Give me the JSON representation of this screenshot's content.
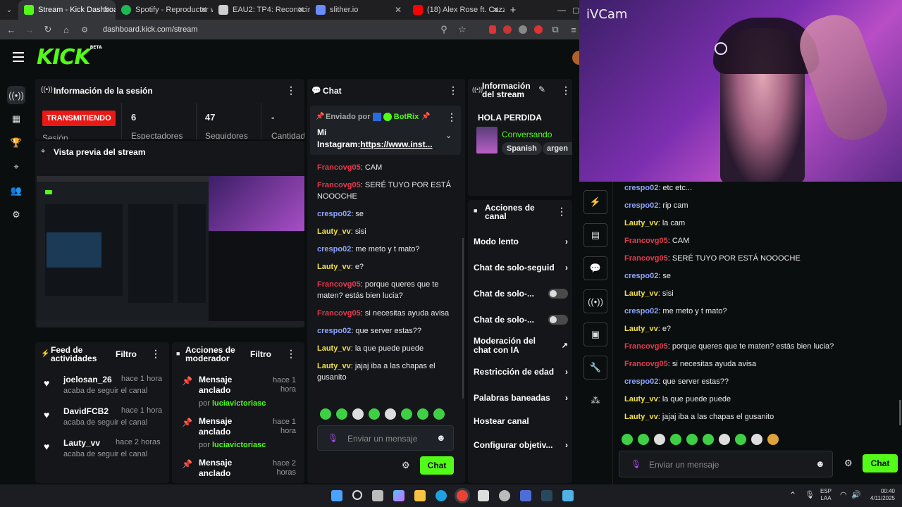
{
  "browser": {
    "tabs": [
      {
        "title": "Stream - Kick Dashboard",
        "color": "#53fc18"
      },
      {
        "title": "Spotify - Reproductor web",
        "color": "#1db954"
      },
      {
        "title": "EAU2: TP4: Reconocimien",
        "color": "#cfcfcf"
      },
      {
        "title": "slither.io",
        "color": "#6a8cff"
      },
      {
        "title": "(18) Alex Rose ft. Cazz",
        "color": "#ff0000"
      }
    ],
    "url": "dashboard.kick.com/stream"
  },
  "kick": {
    "logo": "KICK",
    "logo_suffix": "BETA",
    "session": {
      "title": "Información de la sesión",
      "status": "TRANSMITIENDO",
      "stats": [
        {
          "value": "6",
          "label": "Espectadores"
        },
        {
          "value": "47",
          "label": "Seguidores"
        },
        {
          "value": "-",
          "label": "Cantidad"
        }
      ],
      "status_label": "Sesión"
    },
    "preview": {
      "title": "Vista previa del stream"
    },
    "feed": {
      "title": "Feed de actividades",
      "filter": "Filtro",
      "items": [
        {
          "user": "joelosan_26",
          "desc": "acaba de seguir el canal",
          "time": "hace 1 hora"
        },
        {
          "user": "DavidFCB2",
          "desc": "acaba de seguir el canal",
          "time": "hace 1 hora"
        },
        {
          "user": "Lauty_vv",
          "desc": "acaba de seguir el canal",
          "time": "hace 2 horas"
        }
      ]
    },
    "modactions": {
      "title": "Acciones de moderador",
      "filter": "Filtro",
      "items": [
        {
          "title": "Mensaje anclado",
          "by_prefix": "por",
          "by": "luciavictoriasc",
          "time": "hace 1 hora"
        },
        {
          "title": "Mensaje anclado",
          "by_prefix": "por",
          "by": "luciavictoriasc",
          "time": "hace 1 hora"
        },
        {
          "title": "Mensaje anclado",
          "by_prefix": "",
          "by": "",
          "time": "hace 2 horas"
        }
      ]
    },
    "chat": {
      "title": "Chat",
      "pinned_prefix": "Enviado por",
      "pinned_by": "BotRix",
      "pinned_msg_line1": "Mi",
      "pinned_msg_line2": "Instagram:",
      "pinned_link": "https://www.inst...",
      "messages": [
        {
          "user": "Francovg05",
          "color": "red",
          "text": ": CAM"
        },
        {
          "user": "Francovg05",
          "color": "red",
          "text": ": SERÉ TUYO POR ESTÁ NOOOCHE"
        },
        {
          "user": "crespo02",
          "color": "blue",
          "text": ": se"
        },
        {
          "user": "Lauty_vv",
          "color": "yellow",
          "text": ": sisi"
        },
        {
          "user": "crespo02",
          "color": "blue",
          "text": ": me meto y t mato?"
        },
        {
          "user": "Lauty_vv",
          "color": "yellow",
          "text": ": e?"
        },
        {
          "user": "Francovg05",
          "color": "red",
          "text": ": porque queres que te maten? estás bien lucia?"
        },
        {
          "user": "Francovg05",
          "color": "red",
          "text": ": si necesitas ayuda avisa"
        },
        {
          "user": "crespo02",
          "color": "blue",
          "text": ": que server estas??"
        },
        {
          "user": "Lauty_vv",
          "color": "yellow",
          "text": ": la que puede puede"
        },
        {
          "user": "Lauty_vv",
          "color": "yellow",
          "text": ": jajaj iba a las chapas el gusanito"
        }
      ],
      "placeholder": "Enviar un mensaje",
      "send": "Chat"
    },
    "streaminfo": {
      "title": "Información del stream",
      "stream_title": "HOLA PERDIDA",
      "category": "Conversando",
      "tags": [
        "Spanish",
        "argen"
      ]
    },
    "channelactions": {
      "title": "Acciones de canal",
      "items": [
        {
          "label": "Modo lento",
          "control": "arrow"
        },
        {
          "label": "Chat de solo-seguid",
          "control": "arrow"
        },
        {
          "label": "Chat de solo-...",
          "control": "toggle"
        },
        {
          "label": "Chat de solo-...",
          "control": "toggle"
        },
        {
          "label": "Moderación del chat con IA",
          "control": "external"
        },
        {
          "label": "Restricción de edad",
          "control": "arrow"
        },
        {
          "label": "Palabras baneadas",
          "control": "arrow"
        },
        {
          "label": "Hostear canal",
          "control": "none"
        },
        {
          "label": "Configurar objetiv...",
          "control": "arrow"
        }
      ]
    }
  },
  "ivcam": {
    "title": "iVCam"
  },
  "rightchat": {
    "messages": [
      {
        "user": "crespo02",
        "color": "blue",
        "text": ": etc etc..."
      },
      {
        "user": "crespo02",
        "color": "blue",
        "text": ": rip cam"
      },
      {
        "user": "Lauty_vv",
        "color": "yellow",
        "text": ": la cam"
      },
      {
        "user": "Francovg05",
        "color": "red",
        "text": ": CAM"
      },
      {
        "user": "Francovg05",
        "color": "red",
        "text": ": SERÉ TUYO POR ESTÁ NOOOCHE"
      },
      {
        "user": "crespo02",
        "color": "blue",
        "text": ": se"
      },
      {
        "user": "Lauty_vv",
        "color": "yellow",
        "text": ": sisi"
      },
      {
        "user": "crespo02",
        "color": "blue",
        "text": ": me meto y t mato?"
      },
      {
        "user": "Lauty_vv",
        "color": "yellow",
        "text": ": e?"
      },
      {
        "user": "Francovg05",
        "color": "red",
        "text": ": porque queres que te maten? estás bien lucia?"
      },
      {
        "user": "Francovg05",
        "color": "red",
        "text": ": si necesitas ayuda avisa"
      },
      {
        "user": "crespo02",
        "color": "blue",
        "text": ": que server estas??"
      },
      {
        "user": "Lauty_vv",
        "color": "yellow",
        "text": ": la que puede puede"
      },
      {
        "user": "Lauty_vv",
        "color": "yellow",
        "text": ": jajaj iba a las chapas el gusanito"
      }
    ],
    "placeholder": "Enviar un mensaje",
    "send": "Chat"
  },
  "taskbar": {
    "lang_top": "ESP",
    "lang_bottom": "LAA",
    "time": "00:40",
    "date": "4/11/2025"
  },
  "colors": {
    "accent": "#53fc18",
    "live": "#e91916"
  }
}
